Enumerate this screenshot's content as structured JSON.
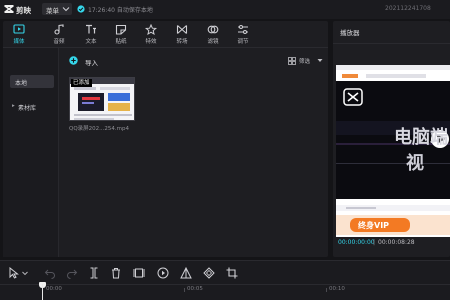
{
  "app": {
    "name": "剪映",
    "menu_label": "菜单",
    "save_status": "17:26:40 自动保存本地",
    "project_id": "202112241708"
  },
  "toolbar": {
    "items": [
      {
        "label": "媒体",
        "icon": "media-icon",
        "active": true
      },
      {
        "label": "音频",
        "icon": "audio-icon",
        "active": false
      },
      {
        "label": "文本",
        "icon": "text-icon",
        "active": false
      },
      {
        "label": "贴纸",
        "icon": "sticker-icon",
        "active": false
      },
      {
        "label": "特效",
        "icon": "effects-icon",
        "active": false
      },
      {
        "label": "转场",
        "icon": "transition-icon",
        "active": false
      },
      {
        "label": "滤镜",
        "icon": "filter-icon",
        "active": false
      },
      {
        "label": "调节",
        "icon": "adjust-icon",
        "active": false
      }
    ]
  },
  "sidebar": {
    "items": [
      {
        "label": "本地",
        "active": true
      },
      {
        "label": "素材库",
        "active": false,
        "prefix": "▸"
      }
    ]
  },
  "media": {
    "import_label": "导入",
    "sort_label": "筛选",
    "clips": [
      {
        "badge": "已添加",
        "name": "QQ录屏202...254.mp4"
      }
    ]
  },
  "player": {
    "title": "播放器",
    "time_current": "00:00:00:00",
    "time_separator": "|",
    "time_total": "00:00:08:28",
    "overlay_text_1": "电脑端",
    "overlay_text_2": "视",
    "banner_text": "终身VIP"
  },
  "timeline": {
    "tools": [
      "select-icon",
      "undo-icon",
      "redo-icon",
      "split-icon",
      "delete-icon",
      "freeze-icon",
      "play-icon",
      "mirror-icon",
      "rotate-icon",
      "crop-icon"
    ],
    "ticks": [
      "00:00",
      "00:05",
      "00:10"
    ]
  },
  "colors": {
    "accent": "#35d6ea",
    "background": "#141417",
    "panel": "#1e1e22"
  }
}
